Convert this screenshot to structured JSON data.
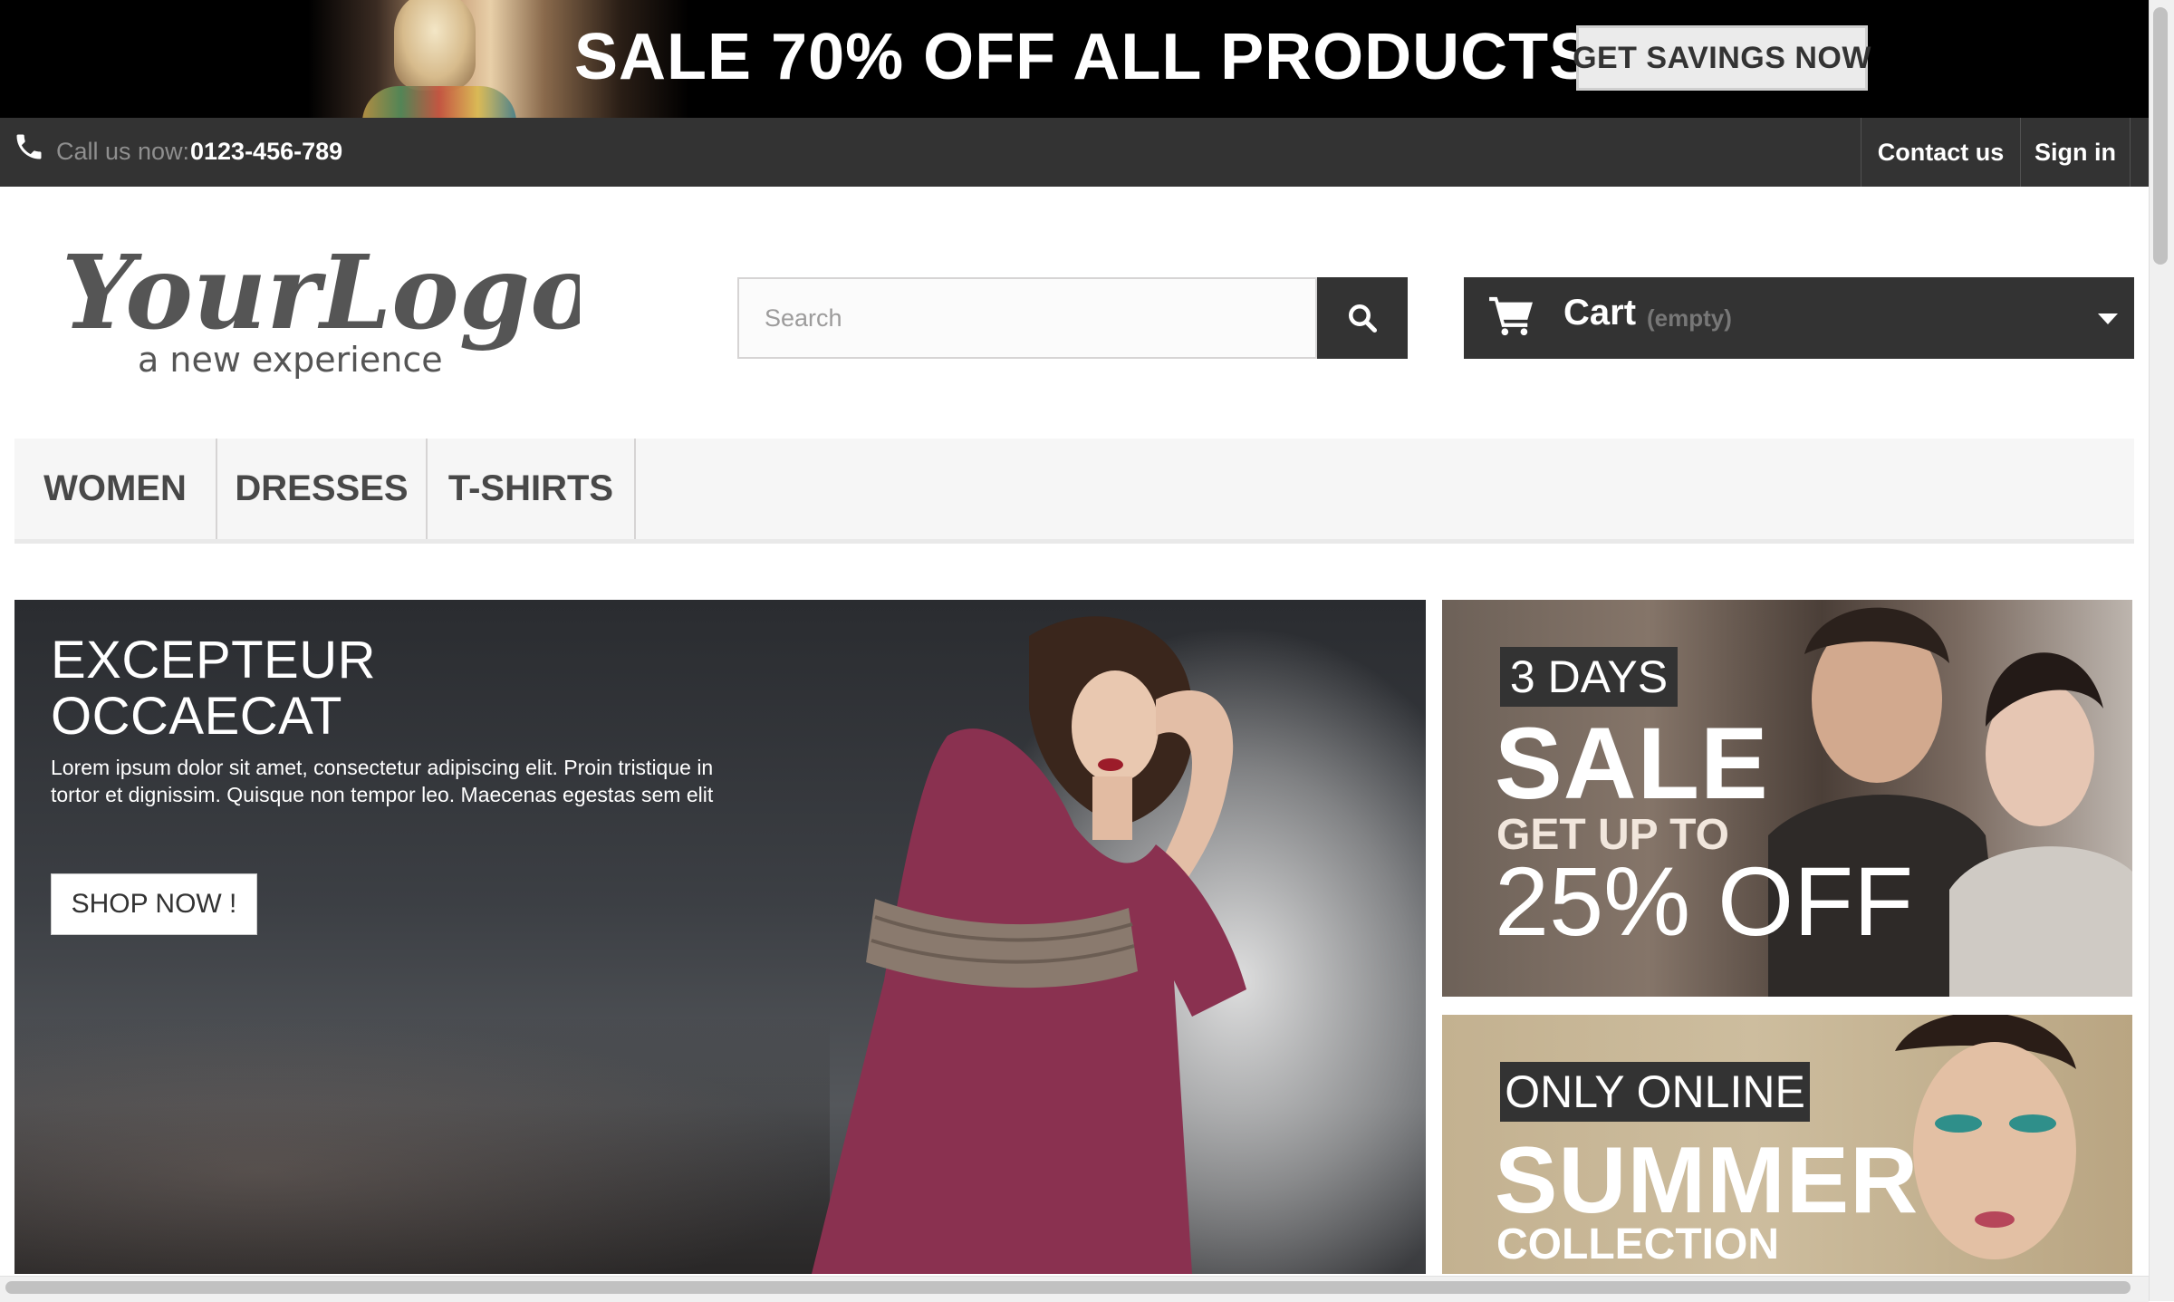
{
  "promo_banner": {
    "headline": "SALE 70% OFF ALL PRODUCTS",
    "cta_label": "GET SAVINGS NOW"
  },
  "top_nav": {
    "call_label": "Call us now:",
    "phone_number": "0123-456-789",
    "contact_label": "Contact us",
    "signin_label": "Sign in"
  },
  "header": {
    "logo_text": "YourLogo",
    "logo_tagline": "a new experience",
    "search_placeholder": "Search",
    "cart_label": "Cart",
    "cart_status": "(empty)"
  },
  "menu": {
    "items": [
      {
        "label": "WOMEN"
      },
      {
        "label": "DRESSES"
      },
      {
        "label": "T-SHIRTS"
      }
    ]
  },
  "slider": {
    "title": "EXCEPTEUR\nOCCAECAT",
    "text": "Lorem ipsum dolor sit amet, consectetur adipiscing elit. Proin tristique in tortor et dignissim. Quisque non tempor leo. Maecenas egestas sem elit",
    "button_label": "SHOP NOW !"
  },
  "banners": {
    "sale": {
      "tag": "3 DAYS",
      "big": "SALE",
      "mid": "GET UP TO",
      "percent": "25% OFF"
    },
    "summer": {
      "tag": "ONLY ONLINE",
      "big": "SUMMER",
      "small": "COLLECTION"
    }
  },
  "colors": {
    "dark": "#333333",
    "menu_bg": "#f6f6f6",
    "promo_bg": "#000000",
    "border": "#d6d4d4"
  },
  "icons": {
    "phone": "phone-icon",
    "search": "search-icon",
    "cart": "cart-icon",
    "caret": "chevron-down-icon"
  }
}
